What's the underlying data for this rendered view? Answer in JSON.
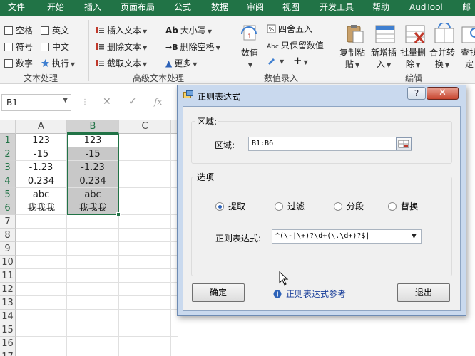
{
  "menu": {
    "tabs": [
      "文件",
      "开始",
      "插入",
      "页面布局",
      "公式",
      "数据",
      "审阅",
      "视图",
      "开发工具",
      "帮助",
      "AudTool",
      "邮"
    ]
  },
  "ribbon": {
    "text_processing": {
      "items": [
        "空格",
        "英文",
        "符号",
        "中文",
        "数字",
        "执行"
      ],
      "group_label": "文本处理"
    },
    "advanced_text": {
      "items": [
        "插入文本",
        "删除文本",
        "截取文本",
        "大小写",
        "删除空格",
        "更多"
      ],
      "group_label": "高级文本处理"
    },
    "number_entry": {
      "value_label": "数值",
      "round_label": "四舍五入",
      "keep_values_label": "只保留数值",
      "group_label": "数值录入"
    },
    "edit": {
      "buttons": [
        {
          "line1": "复制粘",
          "line2": "贴"
        },
        {
          "line1": "新增插",
          "line2": "入"
        },
        {
          "line1": "批量删",
          "line2": "除"
        },
        {
          "line1": "合并转",
          "line2": "换"
        },
        {
          "line1": "查找",
          "line2": "定"
        }
      ],
      "group_label": "编辑"
    }
  },
  "formula_bar": {
    "name_box": "B1",
    "fx": "fx"
  },
  "sheet": {
    "columns": [
      "A",
      "B",
      "C"
    ],
    "rows": [
      "1",
      "2",
      "3",
      "4",
      "5",
      "6",
      "7",
      "8",
      "9",
      "10",
      "11",
      "12",
      "13",
      "14",
      "15",
      "16",
      "17"
    ],
    "colA": [
      "123",
      "-15",
      "-1.23",
      "0.234",
      "abc",
      "我我我"
    ],
    "colB": [
      "123",
      "-15",
      "-1.23",
      "0.234",
      "abc",
      "我我我"
    ]
  },
  "dialog": {
    "title": "正则表达式",
    "help": "?",
    "close": "✕",
    "region_section": "区域:",
    "region_label": "区域:",
    "region_value": "B1:B6",
    "options_section": "选项",
    "radios": [
      {
        "label": "提取",
        "checked": true
      },
      {
        "label": "过滤",
        "checked": false
      },
      {
        "label": "分段",
        "checked": false
      },
      {
        "label": "替换",
        "checked": false
      }
    ],
    "regex_label": "正则表达式:",
    "regex_value": "^(\\-|\\+)?\\d+(\\.\\d+)?$|",
    "confirm": "确定",
    "reference_link": "正则表达式参考",
    "exit": "退出"
  },
  "colors": {
    "excel_green": "#217346",
    "selection_fill": "#c8c8c8",
    "dialog_frame": "#c9d9ee",
    "close_red": "#c8452f"
  }
}
